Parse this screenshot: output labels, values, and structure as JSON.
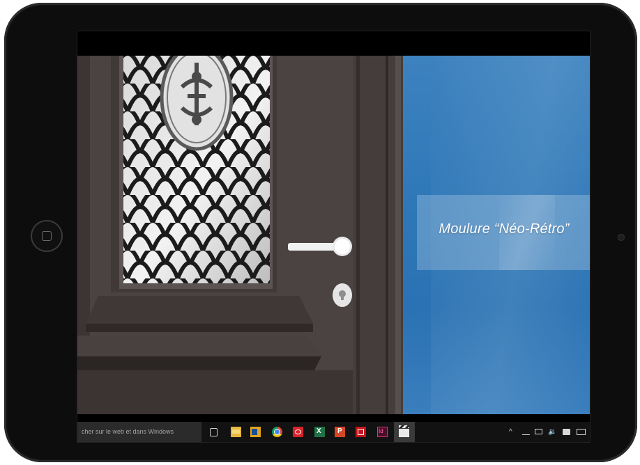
{
  "video": {
    "title_overlay": "Moulure “Néo-Rétro”",
    "panel_color": "#2f78b8",
    "door_color": "#4a4341"
  },
  "taskbar": {
    "search_placeholder": "cher sur le web et dans Windows",
    "pinned_apps": [
      "task-view",
      "file-explorer",
      "outlook",
      "chrome",
      "red-app",
      "excel",
      "powerpoint",
      "acrobat",
      "indesign",
      "video-player"
    ],
    "tray_icons": [
      "chevron-up",
      "network",
      "monitor",
      "volume",
      "action-center",
      "keyboard"
    ],
    "tray_chevron_glyph": "^",
    "tray_volume_glyph": "🔉"
  }
}
